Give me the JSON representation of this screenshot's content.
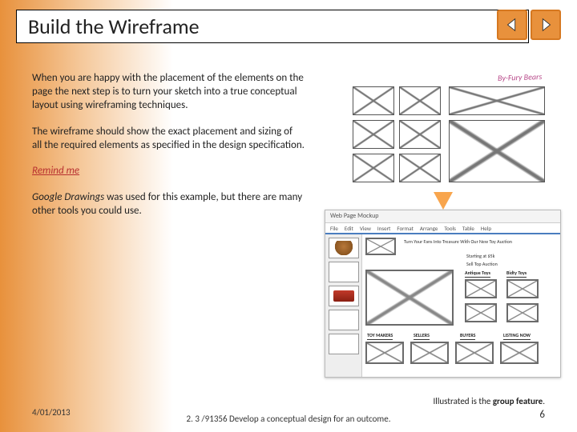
{
  "title": "Build the Wireframe",
  "paragraphs": {
    "p1": "When you are happy with the placement of the elements on the page the next step is to turn your sketch into a true conceptual layout using wireframing techniques.",
    "p2": "The wireframe should show the exact placement and sizing of all the required elements as specified in the design specification.",
    "remind": "Remind me",
    "p3a": "Google Drawings",
    "p3b": " was used for this example, but there are many other tools you could use."
  },
  "sketch_label": "By-Fury Bears",
  "mockup": {
    "window_title": "Web Page Mockup",
    "menu": [
      "File",
      "Edit",
      "View",
      "Insert",
      "Format",
      "Arrange",
      "Tools",
      "Table",
      "Help"
    ],
    "headline": "Turn Your Fans Into Treasure With Our New Toy Auction",
    "sub1": "Starting at $5k",
    "sub2": "Sell Top Auction",
    "labels": {
      "a": "Antique Toys",
      "b": "Bidty Toys"
    },
    "bottom": [
      "TOY MAKERS",
      "SELLERS",
      "BUYERS",
      "LISTING NOW"
    ]
  },
  "caption": {
    "pre": "Illustrated is the ",
    "bold": "group feature",
    "post": "."
  },
  "footer": {
    "date": "4/01/2013",
    "center": "2. 3 /91356 Develop a conceptual design for an outcome.",
    "page": "6"
  }
}
